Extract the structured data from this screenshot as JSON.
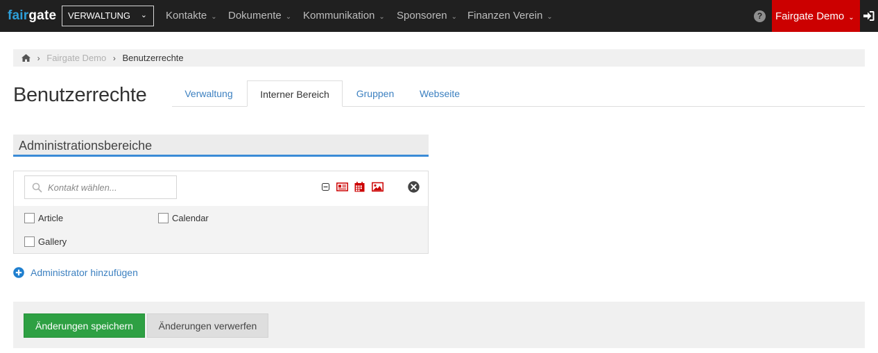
{
  "navbar": {
    "logo_part1": "fair",
    "logo_part2": "gate",
    "module": "VERWALTUNG",
    "items": [
      {
        "label": "Kontakte"
      },
      {
        "label": "Dokumente"
      },
      {
        "label": "Kommunikation"
      },
      {
        "label": "Sponsoren"
      },
      {
        "label": "Finanzen Verein"
      }
    ],
    "help": "?",
    "user": "Fairgate Demo"
  },
  "breadcrumb": {
    "parent": "Fairgate Demo",
    "current": "Benutzerrechte"
  },
  "page": {
    "title": "Benutzerrechte",
    "tabs": [
      {
        "label": "Verwaltung",
        "active": false
      },
      {
        "label": "Interner Bereich",
        "active": true
      },
      {
        "label": "Gruppen",
        "active": false
      },
      {
        "label": "Webseite",
        "active": false
      }
    ]
  },
  "section": {
    "title": "Administrationsbereiche"
  },
  "admin_row": {
    "search_placeholder": "Kontakt wählen...",
    "search_value": "",
    "type_icons": [
      "article-icon",
      "calendar-icon",
      "gallery-icon"
    ],
    "checkboxes": [
      {
        "label": "Article",
        "checked": false
      },
      {
        "label": "Calendar",
        "checked": false
      },
      {
        "label": "Gallery",
        "checked": false
      }
    ]
  },
  "add_admin": "Administrator hinzufügen",
  "actions": {
    "save": "Änderungen speichern",
    "discard": "Änderungen verwerfen"
  },
  "colors": {
    "navbar_bg": "#202020",
    "logo_accent": "#2d9fd9",
    "user_menu_bg": "#cc0000",
    "link": "#3c80c0",
    "section_accent": "#3a8bd6",
    "save_button": "#2ea043",
    "icon_red": "#cc0000"
  }
}
